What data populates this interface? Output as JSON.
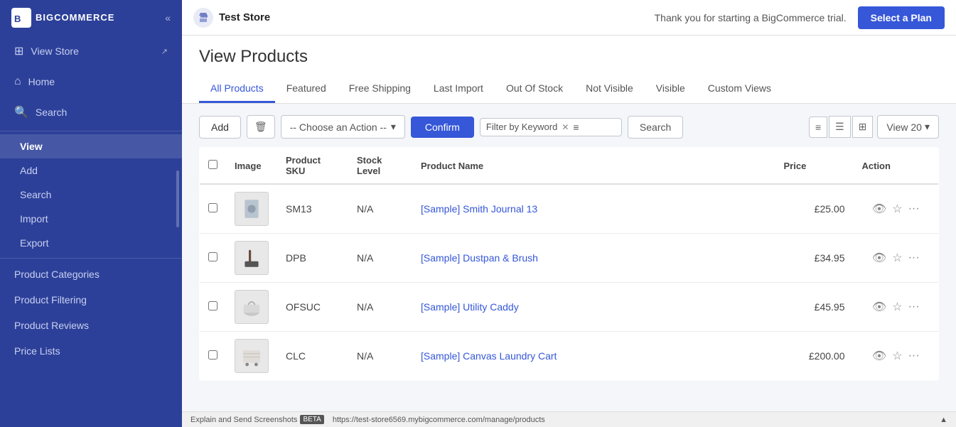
{
  "header": {
    "logo_text": "BIGCOMMERCE",
    "store_name": "Test Store",
    "trial_message": "Thank you for starting a BigCommerce trial.",
    "select_plan_label": "Select a Plan",
    "collapse_icon": "«"
  },
  "sidebar": {
    "top_links": [
      {
        "id": "view-store",
        "label": "View Store",
        "icon": "⊞",
        "has_external": true
      },
      {
        "id": "home",
        "label": "Home",
        "icon": "⌂"
      },
      {
        "id": "search",
        "label": "Search",
        "icon": "🔍"
      }
    ],
    "products_section": [
      {
        "id": "view",
        "label": "View",
        "active": true
      },
      {
        "id": "add",
        "label": "Add"
      },
      {
        "id": "search-products",
        "label": "Search"
      },
      {
        "id": "import",
        "label": "Import"
      },
      {
        "id": "export",
        "label": "Export"
      }
    ],
    "categories_section": [
      {
        "id": "product-categories",
        "label": "Product Categories"
      },
      {
        "id": "product-filtering",
        "label": "Product Filtering"
      },
      {
        "id": "product-reviews",
        "label": "Product Reviews"
      },
      {
        "id": "price-lists",
        "label": "Price Lists"
      }
    ]
  },
  "page": {
    "title": "View Products",
    "tabs": [
      {
        "id": "all-products",
        "label": "All Products",
        "active": true
      },
      {
        "id": "featured",
        "label": "Featured"
      },
      {
        "id": "free-shipping",
        "label": "Free Shipping"
      },
      {
        "id": "last-import",
        "label": "Last Import"
      },
      {
        "id": "out-of-stock",
        "label": "Out Of Stock"
      },
      {
        "id": "not-visible",
        "label": "Not Visible"
      },
      {
        "id": "visible",
        "label": "Visible"
      },
      {
        "id": "custom-views",
        "label": "Custom Views"
      }
    ]
  },
  "toolbar": {
    "add_label": "Add",
    "action_placeholder": "-- Choose an Action --",
    "confirm_label": "Confirm",
    "filter_placeholder": "Filter by Keyword",
    "search_label": "Search",
    "view_count": "View 20"
  },
  "table": {
    "columns": [
      "",
      "Image",
      "Product SKU",
      "Stock Level",
      "Product Name",
      "Price",
      "Action"
    ],
    "rows": [
      {
        "id": "1",
        "sku": "SM13",
        "stock": "N/A",
        "name": "[Sample] Smith Journal 13",
        "price": "£25.00",
        "img_label": "Smith Journal"
      },
      {
        "id": "2",
        "sku": "DPB",
        "stock": "N/A",
        "name": "[Sample] Dustpan & Brush",
        "price": "£34.95",
        "img_label": "Dustpan Brush"
      },
      {
        "id": "3",
        "sku": "OFSUC",
        "stock": "N/A",
        "name": "[Sample] Utility Caddy",
        "price": "£45.95",
        "img_label": "Utility Caddy"
      },
      {
        "id": "4",
        "sku": "CLC",
        "stock": "N/A",
        "name": "[Sample] Canvas Laundry Cart",
        "price": "£200.00",
        "img_label": "Laundry Cart"
      }
    ]
  },
  "status_bar": {
    "text": "https://test-store6569.mybigcommerce.com/manage/products",
    "label": "Explain and Send Screenshots",
    "sub_label": "BETA"
  }
}
